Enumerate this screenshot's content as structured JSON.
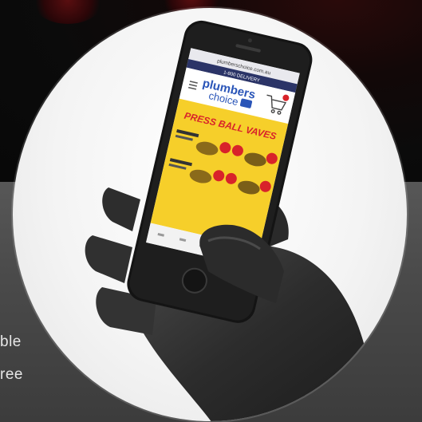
{
  "background_text_lines": [
    "ble",
    "ree"
  ],
  "phone": {
    "url": "plumberschoice.com.au",
    "promo_bar": "1-800 DELIVERY",
    "brand_line1": "plumbers",
    "brand_line2": "choice",
    "banner_title": "PRESS BALL VAVES"
  },
  "colors": {
    "banner_yellow": "#f6cf2a",
    "brand_blue": "#2a55b8",
    "promo_navy": "#2b3467",
    "accent_red": "#d8232a",
    "glove": "#2f2f2f"
  }
}
